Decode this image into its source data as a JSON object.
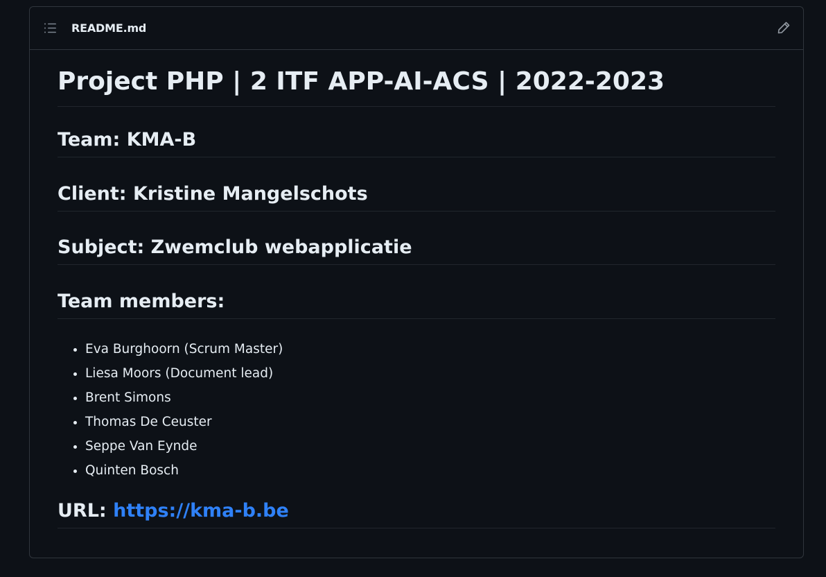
{
  "header": {
    "file_name": "README.md",
    "toc_icon": "list-unordered-icon",
    "edit_icon": "pencil-icon"
  },
  "content": {
    "title": "Project PHP | 2 ITF APP-AI-ACS | 2022-2023",
    "team": "Team: KMA-B",
    "client": "Client: Kristine Mangelschots",
    "subject": "Subject: Zwemclub webapplicatie",
    "members_heading": "Team members:",
    "members": [
      "Eva Burghoorn (Scrum Master)",
      "Liesa Moors (Document lead)",
      "Brent Simons",
      "Thomas De Ceuster",
      "Seppe Van Eynde",
      "Quinten Bosch"
    ],
    "url_label": "URL: ",
    "url_text": "https://kma-b.be",
    "url_href": "https://kma-b.be"
  },
  "colors": {
    "background": "#0d1117",
    "border": "#30363d",
    "text": "#e6edf3",
    "link": "#2f81f7"
  }
}
